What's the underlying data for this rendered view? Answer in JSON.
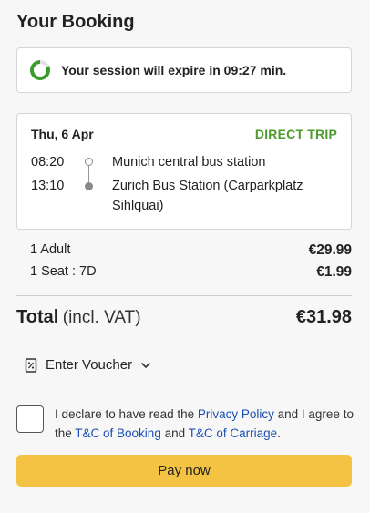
{
  "header": {
    "title": "Your Booking"
  },
  "session": {
    "message": "Your session will expire in 09:27 min.",
    "icon": "timer-icon",
    "color": "#3a9b2c"
  },
  "trip": {
    "date": "Thu, 6 Apr",
    "type": "DIRECT TRIP",
    "type_color": "#4e9a2e",
    "departure": {
      "time": "08:20",
      "station": "Munich central bus station"
    },
    "arrival": {
      "time": "13:10",
      "station": "Zurich Bus Station (Carparkplatz Sihlquai)"
    }
  },
  "prices": [
    {
      "label": "1 Adult",
      "amount": "€29.99"
    },
    {
      "label": "1 Seat : 7D",
      "amount": "€1.99"
    }
  ],
  "total": {
    "label": "Total",
    "suffix": "(incl. VAT)",
    "amount": "€31.98"
  },
  "voucher": {
    "label": "Enter Voucher",
    "icon": "voucher-icon"
  },
  "consent": {
    "text_1": "I declare to have read the ",
    "privacy_link": "Privacy Policy",
    "text_2": " and I agree to the ",
    "booking_link": "T&C of Booking",
    "text_3": " and ",
    "carriage_link": "T&C of Carriage",
    "text_4": ".",
    "checked": false
  },
  "pay_button": {
    "label": "Pay now",
    "color": "#f5c343"
  }
}
